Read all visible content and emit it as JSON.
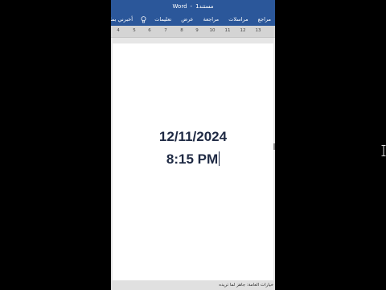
{
  "window": {
    "app_name": "Word",
    "separator": "-",
    "document_name": "مستند1"
  },
  "ribbon": {
    "tabs": [
      "مراجع",
      "مراسلات",
      "مراجعة",
      "عرض",
      "تعليمات"
    ],
    "tell_me": "أخبرني بما تريد",
    "tell_me_icon": "lightbulb-icon"
  },
  "ruler": {
    "ticks": [
      "13",
      "12",
      "11",
      "10",
      "9",
      "8",
      "7",
      "6",
      "5",
      "4"
    ]
  },
  "document": {
    "date": "12/11/2024",
    "time": "8:15 PM"
  },
  "status": {
    "text": "خيارات العامة: جاهز لما تريده"
  },
  "colors": {
    "title_bar": "#2b579a",
    "text": "#1f2a44",
    "background": "#000000"
  }
}
